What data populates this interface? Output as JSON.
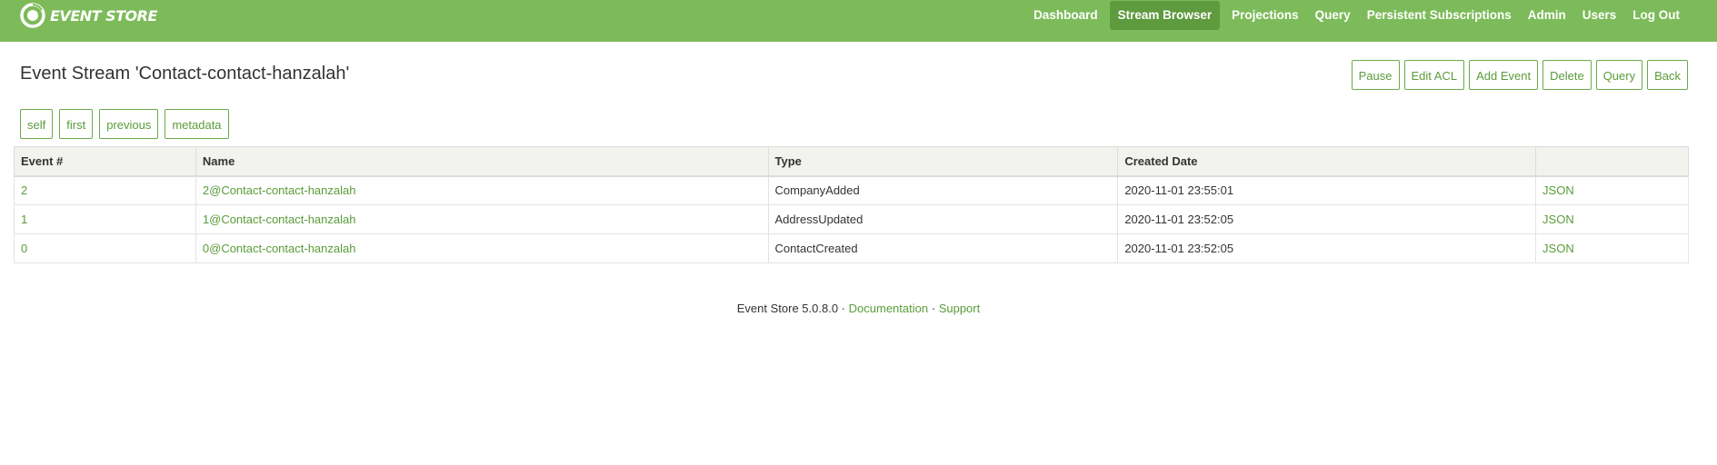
{
  "brand": {
    "name": "EVENT STORE"
  },
  "nav": {
    "items": [
      {
        "label": "Dashboard",
        "active": false
      },
      {
        "label": "Stream Browser",
        "active": true
      },
      {
        "label": "Projections",
        "active": false
      },
      {
        "label": "Query",
        "active": false
      },
      {
        "label": "Persistent Subscriptions",
        "active": false
      },
      {
        "label": "Admin",
        "active": false
      },
      {
        "label": "Users",
        "active": false
      },
      {
        "label": "Log Out",
        "active": false
      }
    ]
  },
  "page": {
    "title": "Event Stream 'Contact-contact-hanzalah'"
  },
  "actions": {
    "pause": "Pause",
    "edit_acl": "Edit ACL",
    "add_event": "Add Event",
    "delete": "Delete",
    "query": "Query",
    "back": "Back"
  },
  "stream_links": {
    "self": "self",
    "first": "first",
    "previous": "previous",
    "metadata": "metadata"
  },
  "table": {
    "headers": {
      "event_number": "Event #",
      "name": "Name",
      "type": "Type",
      "created_date": "Created Date",
      "json": ""
    },
    "rows": [
      {
        "event_number": "2",
        "name": "2@Contact-contact-hanzalah",
        "type": "CompanyAdded",
        "created_date": "2020-11-01 23:55:01",
        "json": "JSON"
      },
      {
        "event_number": "1",
        "name": "1@Contact-contact-hanzalah",
        "type": "AddressUpdated",
        "created_date": "2020-11-01 23:52:05",
        "json": "JSON"
      },
      {
        "event_number": "0",
        "name": "0@Contact-contact-hanzalah",
        "type": "ContactCreated",
        "created_date": "2020-11-01 23:52:05",
        "json": "JSON"
      }
    ]
  },
  "footer": {
    "version": "Event Store 5.0.8.0",
    "separator": "·",
    "documentation": "Documentation",
    "support": "Support"
  },
  "colors": {
    "navbar": "#7dbb5a",
    "nav_active": "#5e9a3e",
    "accent": "#5a9c3a",
    "table_header": "#f2f2ef"
  },
  "icons": {
    "brand_logo": "event-store-logo-icon"
  }
}
